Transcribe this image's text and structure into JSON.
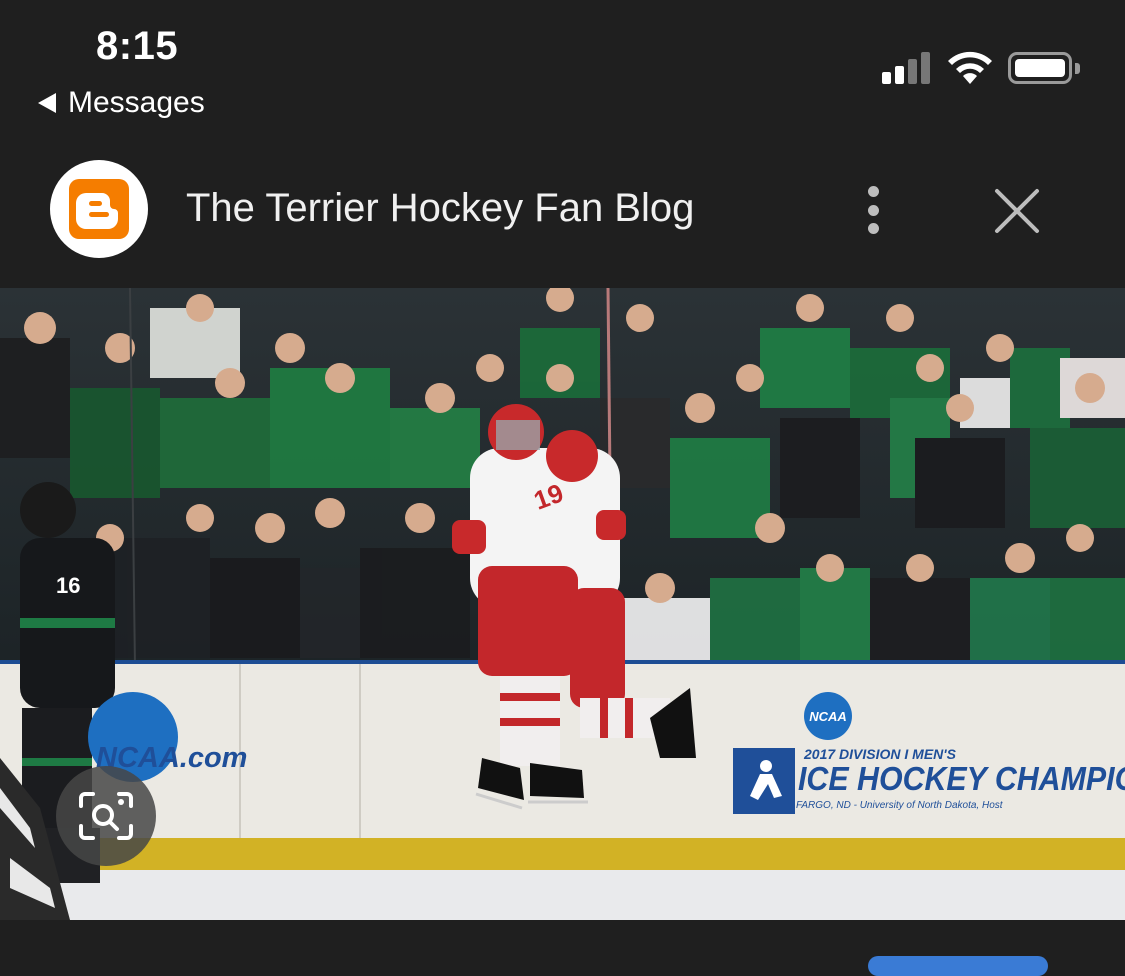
{
  "status_bar": {
    "time": "8:15",
    "back_label": "Messages",
    "icons": [
      "cellular-signal-icon",
      "wifi-icon",
      "battery-icon"
    ]
  },
  "header": {
    "site_icon": "blogger-logo-icon",
    "title": "The Terrier Hockey Fan Blog",
    "more_icon": "more-vertical-icon",
    "close_icon": "close-icon",
    "brand_color": "#f57d00"
  },
  "photo": {
    "ad_board_left": "NCAA.com",
    "ad_board_right_badge": "NCAA",
    "ad_board_right_line1": "2017 DIVISION I MEN'S",
    "ad_board_right_line2": "ICE HOCKEY CHAMPIONS",
    "ad_board_right_line3": "FARGO, ND - University of North Dakota, Host",
    "player_number_left": "16",
    "player_number_center": "19",
    "visual_lookup_icon": "visual-lookup-icon"
  }
}
